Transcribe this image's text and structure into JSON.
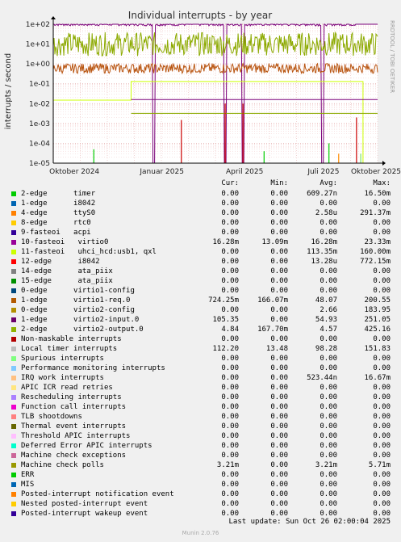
{
  "chart_data": {
    "type": "line",
    "title": "Individual interrupts - by year",
    "ylabel": "interrupts / second",
    "side_label": "RRDTOOL / TOBI OETIKER",
    "y_scale": "log",
    "ylim": [
      1e-05,
      100
    ],
    "y_ticks": [
      "1e-05",
      "1e-04",
      "1e-03",
      "1e-02",
      "1e-01",
      "1e+00",
      "1e+01",
      "1e+02"
    ],
    "x_ticks": [
      "Oktober 2024",
      "Januar 2025",
      "April 2025",
      "Juli 2025",
      "Oktober 2025"
    ],
    "x_tick_pos": [
      0.07,
      0.34,
      0.595,
      0.838,
      1.0
    ],
    "grid": true,
    "series": [
      {
        "name": "virtio2-input.0",
        "color": "#7a007a",
        "level": 100,
        "noise": 0.08,
        "dips": [
          0.31,
          0.53,
          0.585,
          0.83
        ],
        "rise": 0.93
      },
      {
        "name": "virtio2-output.0",
        "color": "#8caa00",
        "level": 10,
        "noise": 0.6
      },
      {
        "name": "virtio1-req.0",
        "color": "#b8540f",
        "level": 0.6,
        "noise": 0.25
      },
      {
        "name": "uhci_hcd:usb1, qxl",
        "color": "#ccff00",
        "level": 0.13,
        "from": 0.24,
        "to": 0.955,
        "before": 0.015
      },
      {
        "name": "virtio0",
        "color": "#7a007a",
        "level": 0.016,
        "from": 0.24
      },
      {
        "name": "Machine check polls",
        "color": "#8caa00",
        "level": 0.0032,
        "from": 0.24
      }
    ],
    "spikes": [
      {
        "x": 0.125,
        "value": 5e-05,
        "color": "#00cc00"
      },
      {
        "x": 0.395,
        "value": 0.0015,
        "color": "#cc0000"
      },
      {
        "x": 0.53,
        "value": 0.01,
        "color": "#cc0000"
      },
      {
        "x": 0.585,
        "value": 0.01,
        "color": "#cc0000"
      },
      {
        "x": 0.65,
        "value": 4e-05,
        "color": "#00cc00"
      },
      {
        "x": 0.85,
        "value": 0.0001,
        "color": "#00cc00"
      },
      {
        "x": 0.88,
        "value": 3e-05,
        "color": "#ff8c00"
      },
      {
        "x": 0.935,
        "value": 0.002,
        "color": "#cc0000"
      },
      {
        "x": 0.948,
        "value": 3e-05,
        "color": "#7ae06a"
      }
    ]
  },
  "legend": {
    "headers": {
      "cur": "Cur:",
      "min": "Min:",
      "avg": "Avg:",
      "max": "Max:"
    },
    "rows": [
      {
        "color": "#00cc00",
        "label": "2-edge      timer",
        "cur": "0.00",
        "min": "0.00",
        "avg": "609.27n",
        "max": "16.50m"
      },
      {
        "color": "#0066b3",
        "label": "1-edge      i8042",
        "cur": "0.00",
        "min": "0.00",
        "avg": "0.00",
        "max": "0.00"
      },
      {
        "color": "#ff8000",
        "label": "4-edge      ttyS0",
        "cur": "0.00",
        "min": "0.00",
        "avg": "2.58u",
        "max": "291.37m"
      },
      {
        "color": "#ffcc00",
        "label": "8-edge      rtc0",
        "cur": "0.00",
        "min": "0.00",
        "avg": "0.00",
        "max": "0.00"
      },
      {
        "color": "#330099",
        "label": "9-fasteoi   acpi",
        "cur": "0.00",
        "min": "0.00",
        "avg": "0.00",
        "max": "0.00"
      },
      {
        "color": "#990099",
        "label": "10-fasteoi   virtio0",
        "cur": "16.28m",
        "min": "13.09m",
        "avg": "16.28m",
        "max": "23.33m"
      },
      {
        "color": "#ccff00",
        "label": "11-fasteoi   uhci_hcd:usb1, qxl",
        "cur": "0.00",
        "min": "0.00",
        "avg": "113.35m",
        "max": "160.00m"
      },
      {
        "color": "#ff0000",
        "label": "12-edge      i8042",
        "cur": "0.00",
        "min": "0.00",
        "avg": "13.28u",
        "max": "772.15m"
      },
      {
        "color": "#808080",
        "label": "14-edge      ata_piix",
        "cur": "0.00",
        "min": "0.00",
        "avg": "0.00",
        "max": "0.00"
      },
      {
        "color": "#008f00",
        "label": "15-edge      ata_piix",
        "cur": "0.00",
        "min": "0.00",
        "avg": "0.00",
        "max": "0.00"
      },
      {
        "color": "#00487d",
        "label": "0-edge      virtio1-config",
        "cur": "0.00",
        "min": "0.00",
        "avg": "0.00",
        "max": "0.00"
      },
      {
        "color": "#b35a00",
        "label": "1-edge      virtio1-req.0",
        "cur": "724.25m",
        "min": "166.07m",
        "avg": "48.07",
        "max": "200.55"
      },
      {
        "color": "#b38f00",
        "label": "0-edge      virtio2-config",
        "cur": "0.00",
        "min": "0.00",
        "avg": "2.66",
        "max": "183.95"
      },
      {
        "color": "#6b006b",
        "label": "1-edge      virtio2-input.0",
        "cur": "105.35",
        "min": "0.00",
        "avg": "54.93",
        "max": "251.05"
      },
      {
        "color": "#8fb300",
        "label": "2-edge      virtio2-output.0",
        "cur": "4.84",
        "min": "167.70m",
        "avg": "4.57",
        "max": "425.16"
      },
      {
        "color": "#b30000",
        "label": "Non-maskable interrupts",
        "cur": "0.00",
        "min": "0.00",
        "avg": "0.00",
        "max": "0.00"
      },
      {
        "color": "#bebebe",
        "label": "Local timer interrupts",
        "cur": "112.20",
        "min": "13.48",
        "avg": "98.28",
        "max": "151.83"
      },
      {
        "color": "#80ff80",
        "label": "Spurious interrupts",
        "cur": "0.00",
        "min": "0.00",
        "avg": "0.00",
        "max": "0.00"
      },
      {
        "color": "#80c9ff",
        "label": "Performance monitoring interrupts",
        "cur": "0.00",
        "min": "0.00",
        "avg": "0.00",
        "max": "0.00"
      },
      {
        "color": "#ffc080",
        "label": "IRQ work interrupts",
        "cur": "0.00",
        "min": "0.00",
        "avg": "523.44n",
        "max": "16.67m"
      },
      {
        "color": "#ffe680",
        "label": "APIC ICR read retries",
        "cur": "0.00",
        "min": "0.00",
        "avg": "0.00",
        "max": "0.00"
      },
      {
        "color": "#aa80ff",
        "label": "Rescheduling interrupts",
        "cur": "0.00",
        "min": "0.00",
        "avg": "0.00",
        "max": "0.00"
      },
      {
        "color": "#ee00cc",
        "label": "Function call interrupts",
        "cur": "0.00",
        "min": "0.00",
        "avg": "0.00",
        "max": "0.00"
      },
      {
        "color": "#ff8080",
        "label": "TLB shootdowns",
        "cur": "0.00",
        "min": "0.00",
        "avg": "0.00",
        "max": "0.00"
      },
      {
        "color": "#666600",
        "label": "Thermal event interrupts",
        "cur": "0.00",
        "min": "0.00",
        "avg": "0.00",
        "max": "0.00"
      },
      {
        "color": "#ffbfff",
        "label": "Threshold APIC interrupts",
        "cur": "0.00",
        "min": "0.00",
        "avg": "0.00",
        "max": "0.00"
      },
      {
        "color": "#00ffcc",
        "label": "Deferred Error APIC interrupts",
        "cur": "0.00",
        "min": "0.00",
        "avg": "0.00",
        "max": "0.00"
      },
      {
        "color": "#cc6699",
        "label": "Machine check exceptions",
        "cur": "0.00",
        "min": "0.00",
        "avg": "0.00",
        "max": "0.00"
      },
      {
        "color": "#999900",
        "label": "Machine check polls",
        "cur": "3.21m",
        "min": "0.00",
        "avg": "3.21m",
        "max": "5.71m"
      },
      {
        "color": "#00cc00",
        "label": "ERR",
        "cur": "0.00",
        "min": "0.00",
        "avg": "0.00",
        "max": "0.00"
      },
      {
        "color": "#0066b3",
        "label": "MIS",
        "cur": "0.00",
        "min": "0.00",
        "avg": "0.00",
        "max": "0.00"
      },
      {
        "color": "#ff8000",
        "label": "Posted-interrupt notification event",
        "cur": "0.00",
        "min": "0.00",
        "avg": "0.00",
        "max": "0.00"
      },
      {
        "color": "#ffcc00",
        "label": "Nested posted-interrupt event",
        "cur": "0.00",
        "min": "0.00",
        "avg": "0.00",
        "max": "0.00"
      },
      {
        "color": "#330099",
        "label": "Posted-interrupt wakeup event",
        "cur": "0.00",
        "min": "0.00",
        "avg": "0.00",
        "max": "0.00"
      }
    ]
  },
  "last_update": "Last update: Sun Oct 26 02:00:04 2025",
  "footer": "Munin 2.0.76"
}
